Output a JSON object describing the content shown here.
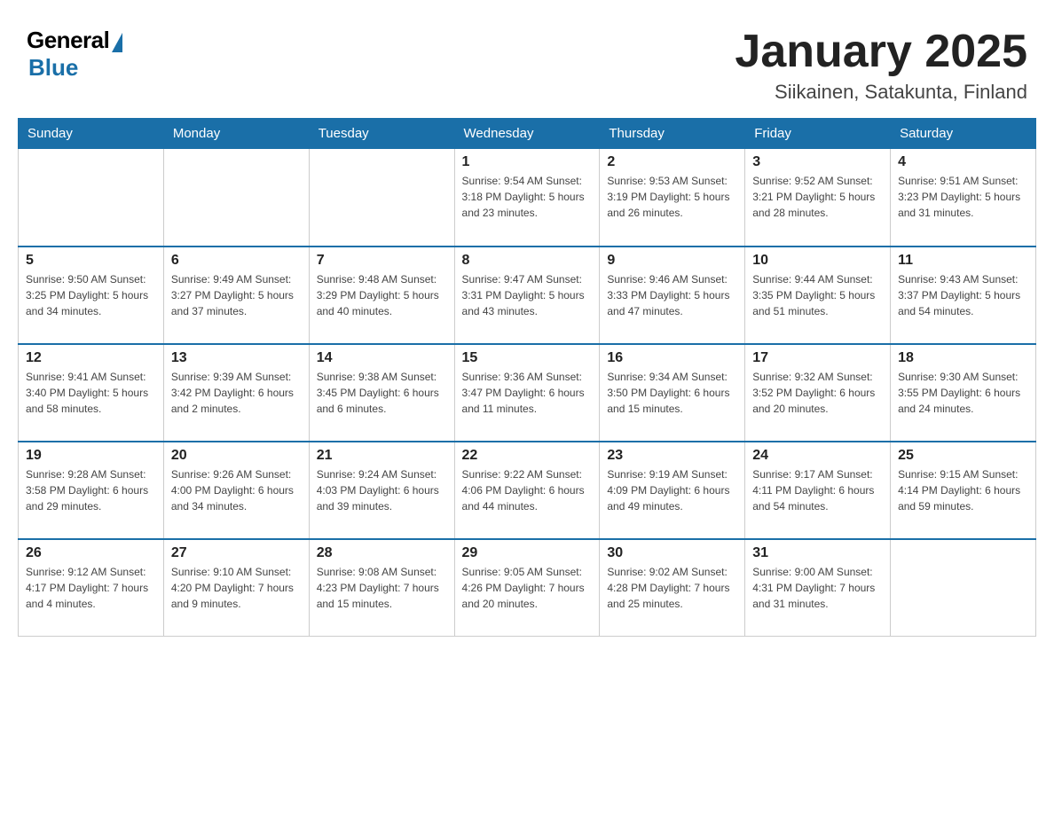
{
  "header": {
    "logo_general": "General",
    "logo_blue": "Blue",
    "month_title": "January 2025",
    "location": "Siikainen, Satakunta, Finland"
  },
  "weekdays": [
    "Sunday",
    "Monday",
    "Tuesday",
    "Wednesday",
    "Thursday",
    "Friday",
    "Saturday"
  ],
  "weeks": [
    [
      {
        "day": "",
        "info": ""
      },
      {
        "day": "",
        "info": ""
      },
      {
        "day": "",
        "info": ""
      },
      {
        "day": "1",
        "info": "Sunrise: 9:54 AM\nSunset: 3:18 PM\nDaylight: 5 hours\nand 23 minutes."
      },
      {
        "day": "2",
        "info": "Sunrise: 9:53 AM\nSunset: 3:19 PM\nDaylight: 5 hours\nand 26 minutes."
      },
      {
        "day": "3",
        "info": "Sunrise: 9:52 AM\nSunset: 3:21 PM\nDaylight: 5 hours\nand 28 minutes."
      },
      {
        "day": "4",
        "info": "Sunrise: 9:51 AM\nSunset: 3:23 PM\nDaylight: 5 hours\nand 31 minutes."
      }
    ],
    [
      {
        "day": "5",
        "info": "Sunrise: 9:50 AM\nSunset: 3:25 PM\nDaylight: 5 hours\nand 34 minutes."
      },
      {
        "day": "6",
        "info": "Sunrise: 9:49 AM\nSunset: 3:27 PM\nDaylight: 5 hours\nand 37 minutes."
      },
      {
        "day": "7",
        "info": "Sunrise: 9:48 AM\nSunset: 3:29 PM\nDaylight: 5 hours\nand 40 minutes."
      },
      {
        "day": "8",
        "info": "Sunrise: 9:47 AM\nSunset: 3:31 PM\nDaylight: 5 hours\nand 43 minutes."
      },
      {
        "day": "9",
        "info": "Sunrise: 9:46 AM\nSunset: 3:33 PM\nDaylight: 5 hours\nand 47 minutes."
      },
      {
        "day": "10",
        "info": "Sunrise: 9:44 AM\nSunset: 3:35 PM\nDaylight: 5 hours\nand 51 minutes."
      },
      {
        "day": "11",
        "info": "Sunrise: 9:43 AM\nSunset: 3:37 PM\nDaylight: 5 hours\nand 54 minutes."
      }
    ],
    [
      {
        "day": "12",
        "info": "Sunrise: 9:41 AM\nSunset: 3:40 PM\nDaylight: 5 hours\nand 58 minutes."
      },
      {
        "day": "13",
        "info": "Sunrise: 9:39 AM\nSunset: 3:42 PM\nDaylight: 6 hours\nand 2 minutes."
      },
      {
        "day": "14",
        "info": "Sunrise: 9:38 AM\nSunset: 3:45 PM\nDaylight: 6 hours\nand 6 minutes."
      },
      {
        "day": "15",
        "info": "Sunrise: 9:36 AM\nSunset: 3:47 PM\nDaylight: 6 hours\nand 11 minutes."
      },
      {
        "day": "16",
        "info": "Sunrise: 9:34 AM\nSunset: 3:50 PM\nDaylight: 6 hours\nand 15 minutes."
      },
      {
        "day": "17",
        "info": "Sunrise: 9:32 AM\nSunset: 3:52 PM\nDaylight: 6 hours\nand 20 minutes."
      },
      {
        "day": "18",
        "info": "Sunrise: 9:30 AM\nSunset: 3:55 PM\nDaylight: 6 hours\nand 24 minutes."
      }
    ],
    [
      {
        "day": "19",
        "info": "Sunrise: 9:28 AM\nSunset: 3:58 PM\nDaylight: 6 hours\nand 29 minutes."
      },
      {
        "day": "20",
        "info": "Sunrise: 9:26 AM\nSunset: 4:00 PM\nDaylight: 6 hours\nand 34 minutes."
      },
      {
        "day": "21",
        "info": "Sunrise: 9:24 AM\nSunset: 4:03 PM\nDaylight: 6 hours\nand 39 minutes."
      },
      {
        "day": "22",
        "info": "Sunrise: 9:22 AM\nSunset: 4:06 PM\nDaylight: 6 hours\nand 44 minutes."
      },
      {
        "day": "23",
        "info": "Sunrise: 9:19 AM\nSunset: 4:09 PM\nDaylight: 6 hours\nand 49 minutes."
      },
      {
        "day": "24",
        "info": "Sunrise: 9:17 AM\nSunset: 4:11 PM\nDaylight: 6 hours\nand 54 minutes."
      },
      {
        "day": "25",
        "info": "Sunrise: 9:15 AM\nSunset: 4:14 PM\nDaylight: 6 hours\nand 59 minutes."
      }
    ],
    [
      {
        "day": "26",
        "info": "Sunrise: 9:12 AM\nSunset: 4:17 PM\nDaylight: 7 hours\nand 4 minutes."
      },
      {
        "day": "27",
        "info": "Sunrise: 9:10 AM\nSunset: 4:20 PM\nDaylight: 7 hours\nand 9 minutes."
      },
      {
        "day": "28",
        "info": "Sunrise: 9:08 AM\nSunset: 4:23 PM\nDaylight: 7 hours\nand 15 minutes."
      },
      {
        "day": "29",
        "info": "Sunrise: 9:05 AM\nSunset: 4:26 PM\nDaylight: 7 hours\nand 20 minutes."
      },
      {
        "day": "30",
        "info": "Sunrise: 9:02 AM\nSunset: 4:28 PM\nDaylight: 7 hours\nand 25 minutes."
      },
      {
        "day": "31",
        "info": "Sunrise: 9:00 AM\nSunset: 4:31 PM\nDaylight: 7 hours\nand 31 minutes."
      },
      {
        "day": "",
        "info": ""
      }
    ]
  ]
}
